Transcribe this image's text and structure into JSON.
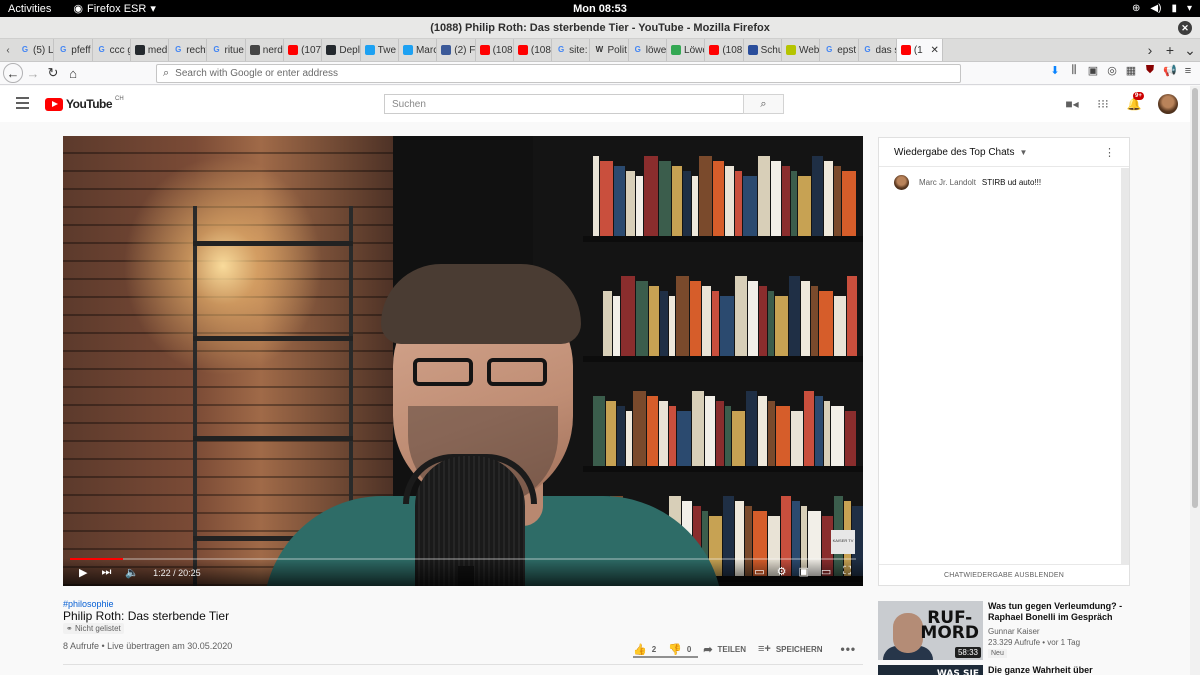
{
  "os": {
    "activities": "Activities",
    "app_name": "Firefox ESR",
    "clock": "Mon 08:53"
  },
  "window": {
    "title": "(1088) Philip Roth: Das sterbende Tier - YouTube - Mozilla Firefox"
  },
  "tabs": [
    {
      "label": "(5) Li",
      "icon": "google-icon",
      "color": "#ffffff"
    },
    {
      "label": "pfeff",
      "icon": "google-icon",
      "color": "#4285f4"
    },
    {
      "label": "ccc g",
      "icon": "google-icon",
      "color": "#4285f4"
    },
    {
      "label": "medi",
      "icon": "github-icon",
      "color": "#24292e"
    },
    {
      "label": "recht",
      "icon": "google-icon",
      "color": "#4285f4"
    },
    {
      "label": "ritue",
      "icon": "google-icon",
      "color": "#4285f4"
    },
    {
      "label": "nerd",
      "icon": "x-circle-icon",
      "color": "#444444"
    },
    {
      "label": "(107",
      "icon": "youtube-icon",
      "color": "#ff0000"
    },
    {
      "label": "Depl",
      "icon": "github-icon",
      "color": "#24292e"
    },
    {
      "label": "Twe",
      "icon": "twitter-icon",
      "color": "#1da1f2"
    },
    {
      "label": "Marc",
      "icon": "twitter-icon",
      "color": "#1da1f2"
    },
    {
      "label": "(2) F",
      "icon": "facebook-icon",
      "color": "#3b5998"
    },
    {
      "label": "(108",
      "icon": "youtube-icon",
      "color": "#ff0000"
    },
    {
      "label": "(108",
      "icon": "youtube-icon",
      "color": "#ff0000"
    },
    {
      "label": "site:",
      "icon": "google-icon",
      "color": "#4285f4"
    },
    {
      "label": "Polit",
      "icon": "wikipedia-icon",
      "color": "#666666"
    },
    {
      "label": "löwe",
      "icon": "google-icon",
      "color": "#4285f4"
    },
    {
      "label": "Löwe",
      "icon": "green-square-icon",
      "color": "#34a853"
    },
    {
      "label": "(108",
      "icon": "youtube-icon",
      "color": "#ff0000"
    },
    {
      "label": "Schu",
      "icon": "flag-icon",
      "color": "#2a4d9b"
    },
    {
      "label": "Web",
      "icon": "circle-icon",
      "color": "#b5c400"
    },
    {
      "label": "epst",
      "icon": "google-icon",
      "color": "#4285f4"
    },
    {
      "label": "das s",
      "icon": "google-icon",
      "color": "#4285f4"
    },
    {
      "label": "(1",
      "icon": "youtube-icon",
      "color": "#ff0000",
      "active": true
    }
  ],
  "urlbar": {
    "placeholder": "Search with Google or enter address"
  },
  "youtube": {
    "logo_text": "YouTube",
    "country": "CH",
    "search_placeholder": "Suchen",
    "notification_count": "9+",
    "brand_color": "#ff0000"
  },
  "player": {
    "current_time": "1:22",
    "duration": "20:25",
    "time_display": "1:22 / 20:25",
    "progress_fraction": 0.067,
    "watermark": "KAISER TV"
  },
  "video": {
    "hashtag": "#philosophie",
    "title": "Philip Roth: Das sterbende Tier",
    "visibility": "Nicht gelistet",
    "meta": "8 Aufrufe • Live übertragen am 30.05.2020",
    "likes": "2",
    "dislikes": "0",
    "share_label": "TEILEN",
    "save_label": "SPEICHERN"
  },
  "chat": {
    "header": "Wiedergabe des Top Chats",
    "messages": [
      {
        "author": "Marc Jr. Landolt",
        "text": "STIRB ud auto!!!"
      }
    ],
    "hide_label": "CHATWIEDERGABE AUSBLENDEN"
  },
  "recommendations": [
    {
      "title": "Was tun gegen Verleumdung? - Raphael Bonelli im Gespräch",
      "channel": "Gunnar Kaiser",
      "views": "23.329 Aufrufe • vor 1 Tag",
      "badge": "Neu",
      "duration": "58:33",
      "thumb_text_1": "RUF-",
      "thumb_text_2": "MORD"
    },
    {
      "title": "Die ganze Wahrheit über",
      "thumb_text_1": "WAS SIE"
    }
  ]
}
